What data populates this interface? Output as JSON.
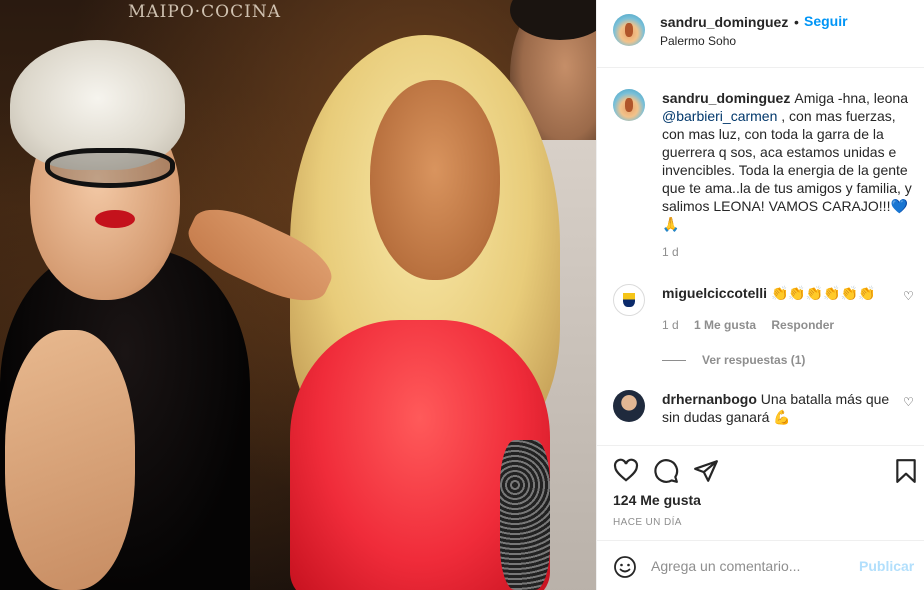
{
  "post": {
    "photo_sign_text": "MAIPO·COCINA",
    "author": {
      "username": "sandru_dominguez",
      "separator": "•",
      "follow_label": "Seguir",
      "location": "Palermo Soho"
    }
  },
  "caption": {
    "username": "sandru_dominguez",
    "text_before": "Amiga -hna, leona ",
    "mention": "@barbieri_carmen",
    "text_after": " , con mas fuerzas, con mas luz, con toda la garra de la guerrera q sos, aca estamos unidas e invencibles. Toda la energia de la gente que te ama..la de tus amigos y familia, y salimos LEONA! VAMOS CARAJO!!!",
    "emoji_heart": "💙",
    "emoji_pray": "🙏",
    "time": "1 d"
  },
  "comments": [
    {
      "username": "miguelciccotelli",
      "text": "👏👏👏👏👏👏",
      "time": "1 d",
      "likes": "1 Me gusta",
      "reply_label": "Responder",
      "view_replies": "Ver respuestas (1)"
    },
    {
      "username": "drhernanbogo",
      "text": "Una batalla más que sin dudas ganará",
      "emoji": "💪"
    }
  ],
  "actions": {
    "likes_count": "124 Me gusta",
    "posted_ago": "HACE UN DÍA",
    "icons": [
      "heart-icon",
      "comment-icon",
      "share-icon",
      "bookmark-icon"
    ]
  },
  "add_comment": {
    "placeholder": "Agrega un comentario...",
    "post_label": "Publicar"
  },
  "colors": {
    "link": "#0095f6",
    "mention": "#00376b",
    "muted": "#8e8e8e",
    "post_disabled": "#b2dffc"
  }
}
